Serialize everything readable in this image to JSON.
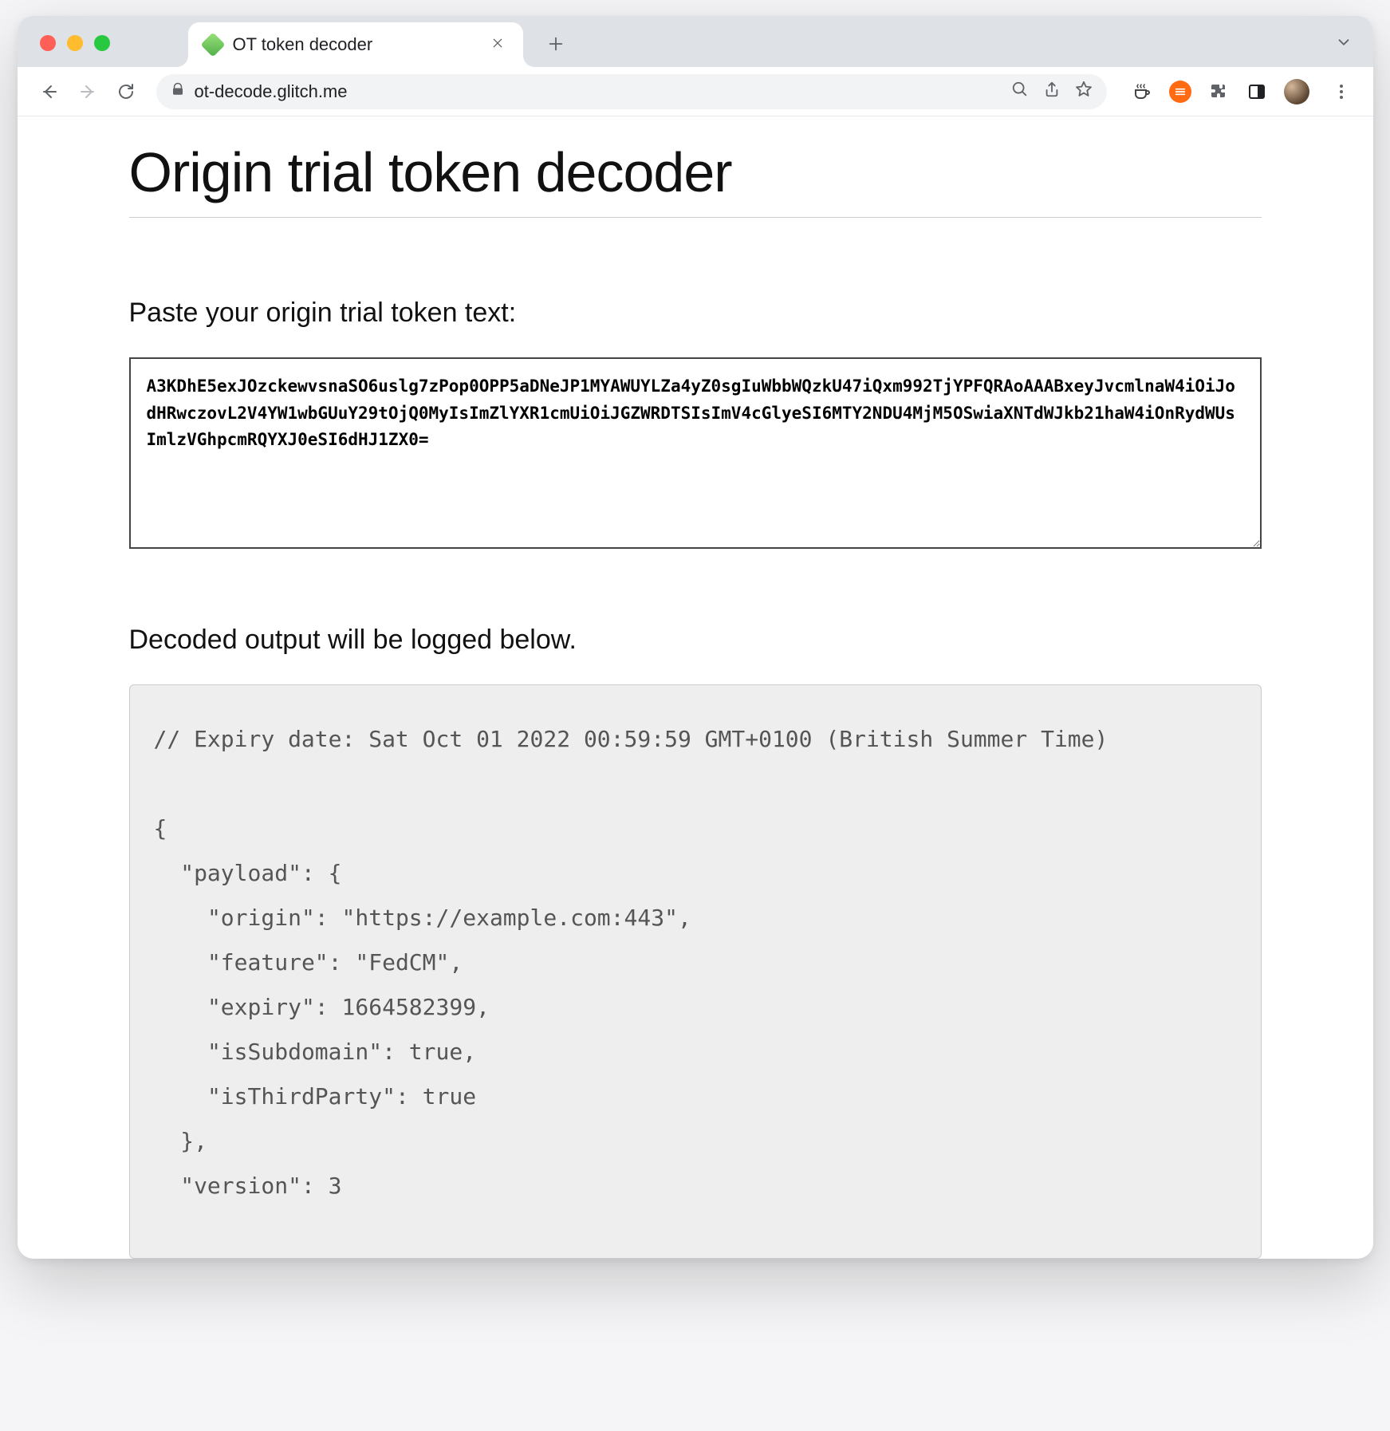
{
  "window": {
    "tab_title": "OT token decoder",
    "url": "ot-decode.glitch.me"
  },
  "page": {
    "heading": "Origin trial token decoder",
    "paste_label": "Paste your origin trial token text:",
    "token_text": "A3KDhE5exJOzckewvsnaSO6uslg7zPop0OPP5aDNeJP1MYAWUYLZa4yZ0sgIuWbbWQzkU47iQxm992TjYPFQRAoAAABxeyJvcmlnaW4iOiJodHRwczovL2V4YW1wbGUuY29tOjQ0MyIsImZlYXR1cmUiOiJGZWRDTSIsImV4cGlyeSI6MTY2NDU4MjM5OSwiaXNTdWJkb21haW4iOnRydWUsImlzVGhpcmRQYXJ0eSI6dHJ1ZX0=",
    "output_label": "Decoded output will be logged below.",
    "output_text": "// Expiry date: Sat Oct 01 2022 00:59:59 GMT+0100 (British Summer Time)\n\n{\n  \"payload\": {\n    \"origin\": \"https://example.com:443\",\n    \"feature\": \"FedCM\",\n    \"expiry\": 1664582399,\n    \"isSubdomain\": true,\n    \"isThirdParty\": true\n  },\n  \"version\": 3"
  }
}
